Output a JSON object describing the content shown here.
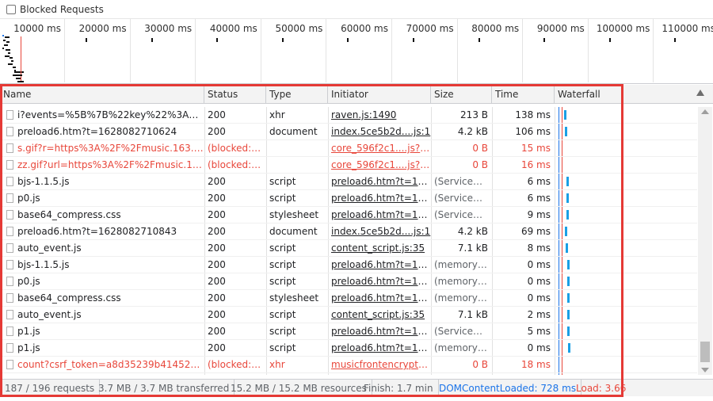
{
  "blocked_requests": {
    "label": "Blocked Requests",
    "checked": false
  },
  "overview": {
    "ticks": [
      "10000 ms",
      "20000 ms",
      "30000 ms",
      "40000 ms",
      "50000 ms",
      "60000 ms",
      "70000 ms",
      "80000 ms",
      "90000 ms",
      "100000 ms",
      "110000 ms"
    ]
  },
  "columns": {
    "name": "Name",
    "status": "Status",
    "type": "Type",
    "initiator": "Initiator",
    "size": "Size",
    "time": "Time",
    "waterfall": "Waterfall"
  },
  "rows": [
    {
      "name": "i?events=%5B%7B%22key%22%3A%22b_...",
      "status": "200",
      "type": "xhr",
      "initiator": "raven.js:1490",
      "size": "213 B",
      "time": "138 ms",
      "blocked": false
    },
    {
      "name": "preload6.htm?t=1628082710624",
      "status": "200",
      "type": "document",
      "initiator": "index.5ce5b2d....js:1",
      "size": "4.2 kB",
      "time": "106 ms",
      "blocked": false
    },
    {
      "name": "s.gif?r=https%3A%2F%2Fmusic.163.com%...",
      "status": "(blocked:ot...",
      "type": "",
      "initiator": "core_596f2c1....js?59...",
      "size": "0 B",
      "time": "15 ms",
      "blocked": true
    },
    {
      "name": "zz.gif?url=https%3A%2F%2Fmusic.163.co...",
      "status": "(blocked:ot...",
      "type": "",
      "initiator": "core_596f2c1....js?59...",
      "size": "0 B",
      "time": "16 ms",
      "blocked": true
    },
    {
      "name": "bjs-1.1.5.js",
      "status": "200",
      "type": "script",
      "initiator": "preload6.htm?t=162...",
      "size": "(ServiceWo...",
      "time": "6 ms",
      "blocked": false
    },
    {
      "name": "p0.js",
      "status": "200",
      "type": "script",
      "initiator": "preload6.htm?t=162...",
      "size": "(ServiceWo...",
      "time": "6 ms",
      "blocked": false
    },
    {
      "name": "base64_compress.css",
      "status": "200",
      "type": "stylesheet",
      "initiator": "preload6.htm?t=162...",
      "size": "(ServiceWo...",
      "time": "9 ms",
      "blocked": false
    },
    {
      "name": "preload6.htm?t=1628082710843",
      "status": "200",
      "type": "document",
      "initiator": "index.5ce5b2d....js:1",
      "size": "4.2 kB",
      "time": "69 ms",
      "blocked": false
    },
    {
      "name": "auto_event.js",
      "status": "200",
      "type": "script",
      "initiator": "content_script.js:35",
      "size": "7.1 kB",
      "time": "8 ms",
      "blocked": false
    },
    {
      "name": "bjs-1.1.5.js",
      "status": "200",
      "type": "script",
      "initiator": "preload6.htm?t=162...",
      "size": "(memory c...",
      "time": "0 ms",
      "blocked": false
    },
    {
      "name": "p0.js",
      "status": "200",
      "type": "script",
      "initiator": "preload6.htm?t=162...",
      "size": "(memory c...",
      "time": "0 ms",
      "blocked": false
    },
    {
      "name": "base64_compress.css",
      "status": "200",
      "type": "stylesheet",
      "initiator": "preload6.htm?t=162...",
      "size": "(memory c...",
      "time": "0 ms",
      "blocked": false
    },
    {
      "name": "auto_event.js",
      "status": "200",
      "type": "script",
      "initiator": "content_script.js:35",
      "size": "7.1 kB",
      "time": "2 ms",
      "blocked": false
    },
    {
      "name": "p1.js",
      "status": "200",
      "type": "script",
      "initiator": "preload6.htm?t=162...",
      "size": "(ServiceWo...",
      "time": "5 ms",
      "blocked": false
    },
    {
      "name": "p1.js",
      "status": "200",
      "type": "script",
      "initiator": "preload6.htm?t=162...",
      "size": "(memory c...",
      "time": "0 ms",
      "blocked": false
    },
    {
      "name": "count?csrf_token=a8d35239b414529246c...",
      "status": "(blocked:ot...",
      "type": "xhr",
      "initiator": "musicfrontencryptval...",
      "size": "0 B",
      "time": "18 ms",
      "blocked": true
    }
  ],
  "status_bar": {
    "requests": "187 / 196 requests",
    "transferred": "3.7 MB / 3.7 MB transferred",
    "resources": "15.2 MB / 15.2 MB resources",
    "finish": "Finish: 1.7 min",
    "dom_content_loaded": "DOMContentLoaded: 728 ms",
    "load": "Load: 3.66"
  },
  "colors": {
    "blocked": "#e8463a",
    "waterfall_bar": "#1a9fe5",
    "dcl_line": "#1a73e8",
    "load_line": "#e8463a",
    "highlight": "#e53935"
  }
}
